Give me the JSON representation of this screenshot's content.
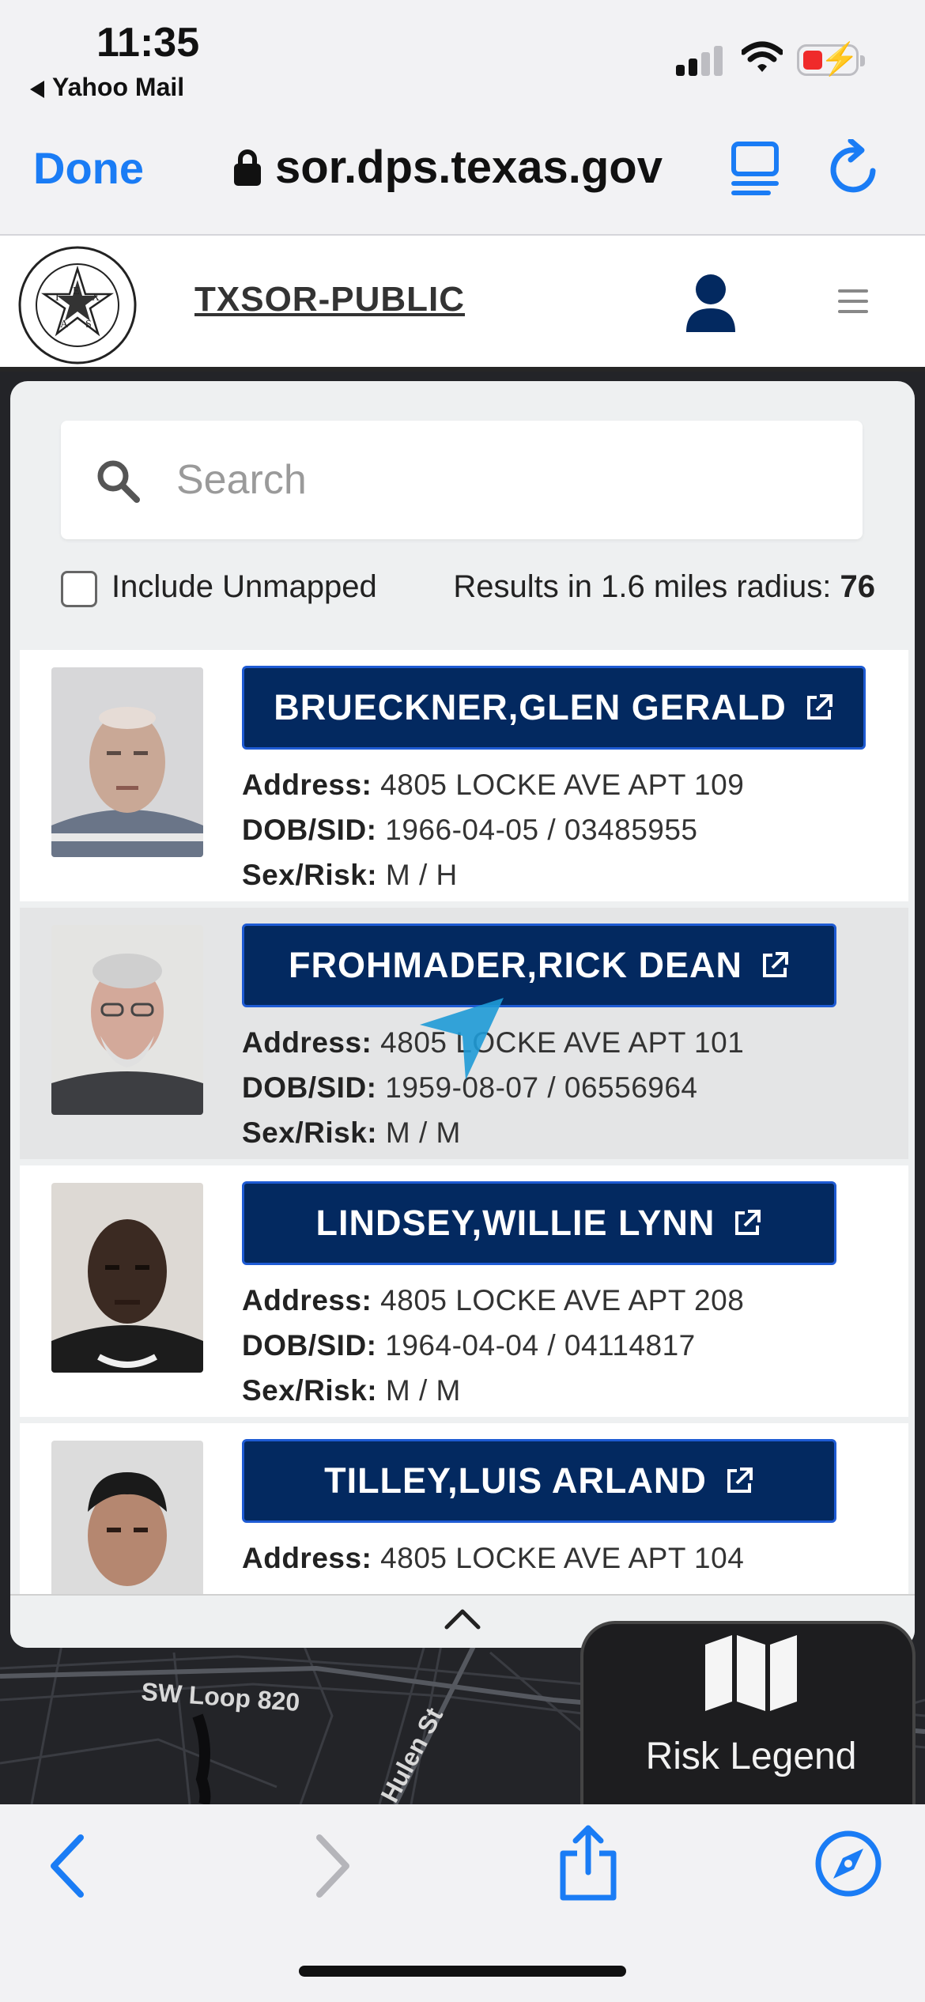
{
  "status_bar": {
    "time": "11:35",
    "back_app": "Yahoo Mail",
    "battery_color": "#ef2a2a"
  },
  "browser": {
    "done_label": "Done",
    "url": "sor.dps.texas.gov",
    "icons": [
      "lock-icon",
      "reader-mode-icon",
      "reload-icon"
    ]
  },
  "site": {
    "brand": "TXSOR-PUBLIC",
    "seal_icon": "texas-dps-seal",
    "seal_letters": [
      "T",
      "E",
      "X",
      "A",
      "S"
    ],
    "seal_text": "DEPARTMENT OF PUBLIC SAFETY",
    "seal_motto": "COURTESY · SERVICE · PROTECTION",
    "accent_color": "#032960"
  },
  "search": {
    "placeholder": "Search",
    "value": ""
  },
  "filters": {
    "include_unmapped_label": "Include Unmapped",
    "include_unmapped_checked": false,
    "results_label": "Results in 1.6 miles radius:",
    "results_count": "76"
  },
  "labels": {
    "address": "Address:",
    "dob_sid": "DOB/SID:",
    "sex_risk": "Sex/Risk:"
  },
  "results": [
    {
      "name": "BRUECKNER,GLEN GERALD",
      "address": "4805 LOCKE AVE APT 109",
      "dob_sid": "1966-04-05 / 03485955",
      "sex_risk": "M / H"
    },
    {
      "name": "FROHMADER,RICK DEAN",
      "address": "4805 LOCKE AVE APT 101",
      "dob_sid": "1959-08-07 / 06556964",
      "sex_risk": "M / M"
    },
    {
      "name": "LINDSEY,WILLIE LYNN",
      "address": "4805 LOCKE AVE APT 208",
      "dob_sid": "1964-04-04 / 04114817",
      "sex_risk": "M / M"
    },
    {
      "name": "TILLEY,LUIS ARLAND",
      "address": "4805 LOCKE AVE APT 104",
      "dob_sid": "",
      "sex_risk": ""
    }
  ],
  "map": {
    "road_labels": [
      "SW Loop 820",
      "Hulen St"
    ]
  },
  "legend": {
    "label": "Risk Legend"
  },
  "toolbar": {
    "icons": [
      "back-icon",
      "forward-icon",
      "share-icon",
      "compass-icon"
    ]
  }
}
